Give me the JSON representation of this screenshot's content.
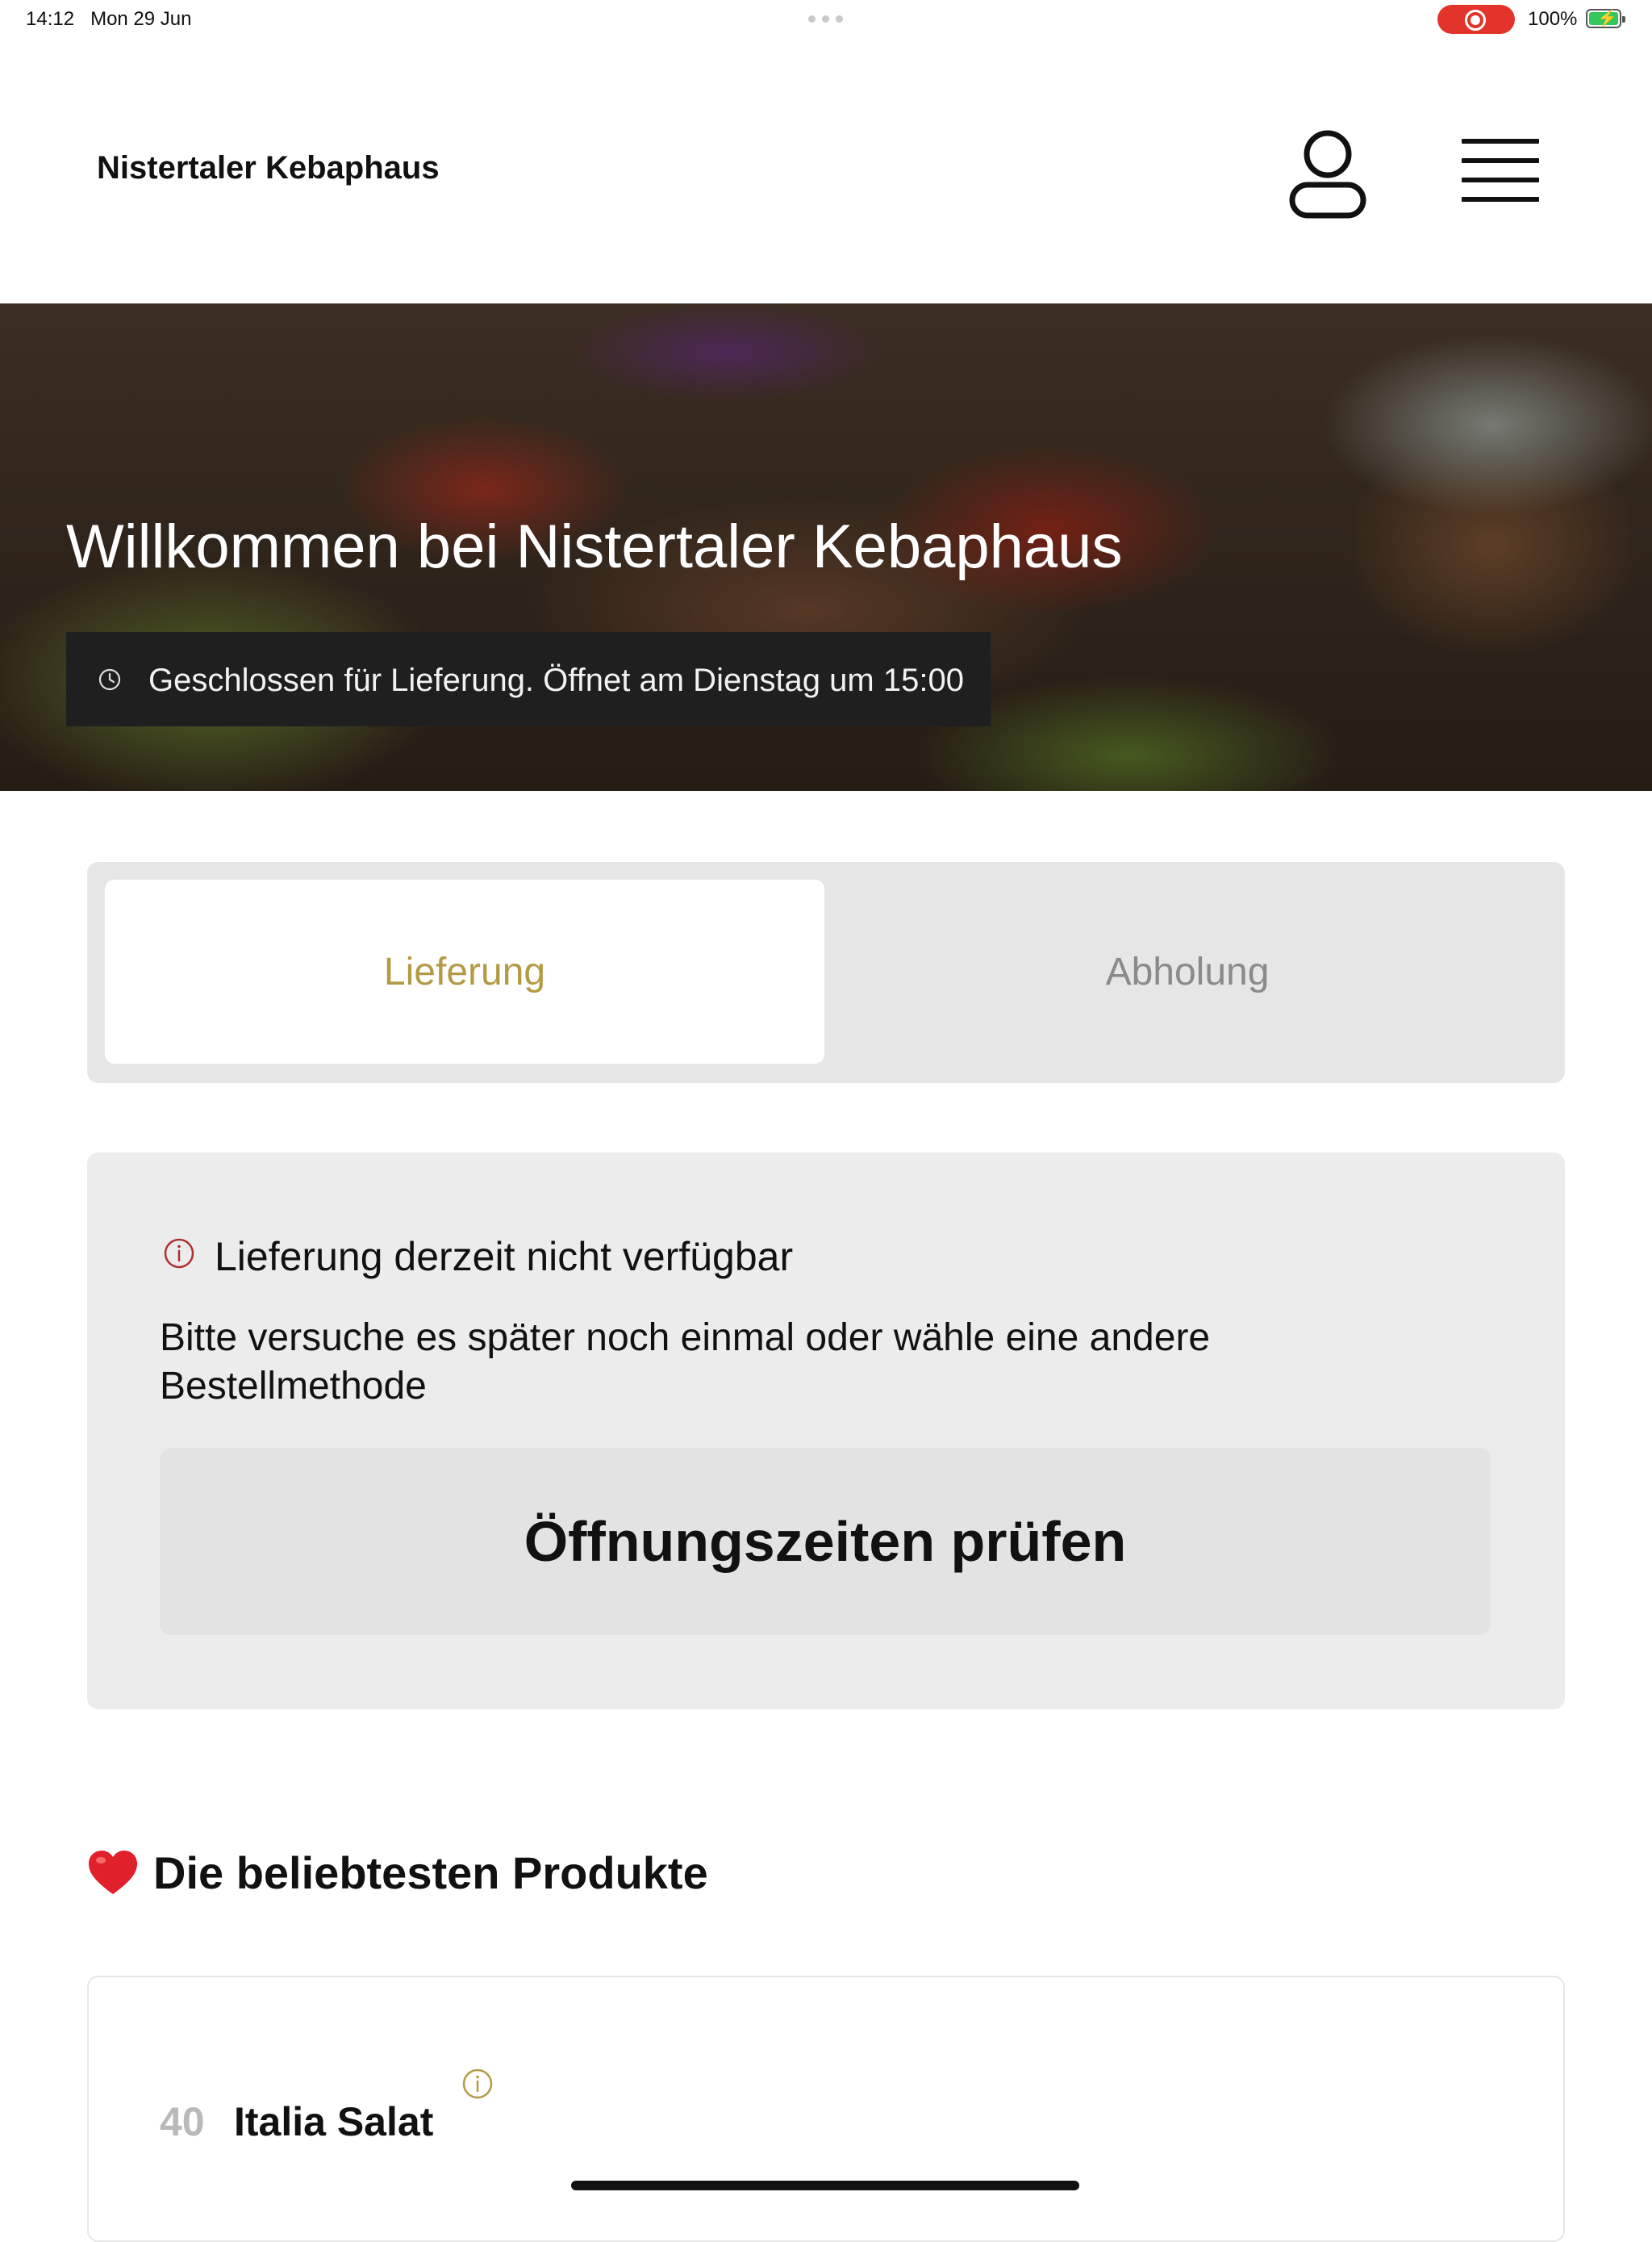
{
  "status_bar": {
    "time": "14:12",
    "date": "Mon 29 Jun",
    "battery": "100%",
    "recording_color": "#e2342b"
  },
  "header": {
    "brand": "Nistertaler Kebaphaus",
    "user_icon": "user-icon",
    "menu_icon": "menu-icon"
  },
  "hero": {
    "title": "Willkommen bei Nistertaler Kebaphaus",
    "status_icon": "clock-icon",
    "status_text": "Geschlossen für Lieferung. Öffnet am Dienstag um 15:00"
  },
  "order_method": {
    "options": [
      {
        "label": "Lieferung",
        "selected": true
      },
      {
        "label": "Abholung",
        "selected": false
      }
    ],
    "accent_color": "#b49a45"
  },
  "notice": {
    "icon": "info-icon",
    "icon_color": "#b03030",
    "title": "Lieferung derzeit nicht verfügbar",
    "body": "Bitte versuche es später noch einmal oder wähle eine andere Bestellmethode",
    "button_label": "Öffnungszeiten prüfen"
  },
  "popular": {
    "icon": "heart-icon",
    "title": "Die beliebtesten Produkte",
    "items": [
      {
        "number": "40",
        "name": "Italia Salat",
        "icon": "info-icon"
      }
    ]
  }
}
